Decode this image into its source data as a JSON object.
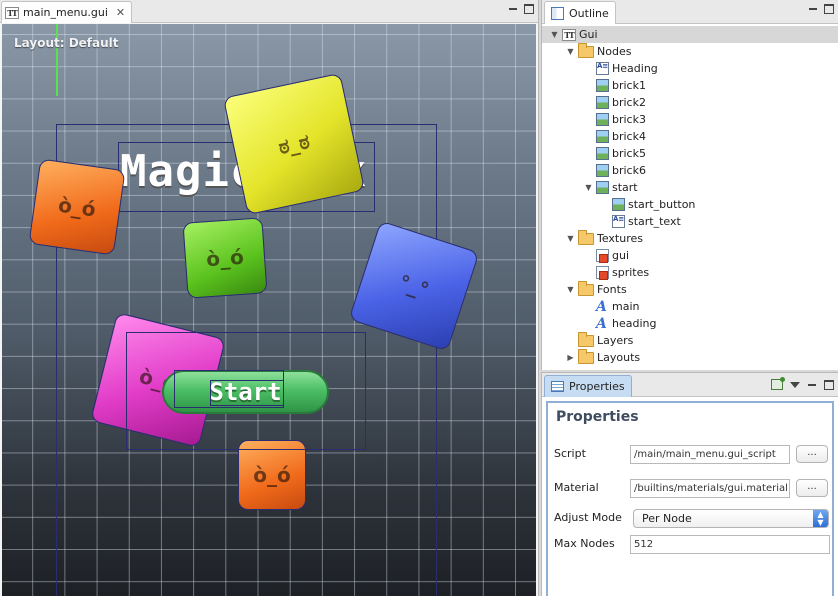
{
  "editor": {
    "tab_label": "main_menu.gui",
    "layout_label": "Layout: Default",
    "heading_text": "Magic Box",
    "start_text": "Start"
  },
  "outline": {
    "tab_label": "Outline",
    "tree": {
      "root": "Gui",
      "nodes_folder": "Nodes",
      "nodes": [
        "Heading",
        "brick1",
        "brick2",
        "brick3",
        "brick4",
        "brick5",
        "brick6",
        "start"
      ],
      "start_children": [
        "start_button",
        "start_text"
      ],
      "textures_folder": "Textures",
      "textures": [
        "gui",
        "sprites"
      ],
      "fonts_folder": "Fonts",
      "fonts": [
        "main",
        "heading"
      ],
      "layers_folder": "Layers",
      "layouts_folder": "Layouts"
    }
  },
  "properties": {
    "tab_label": "Properties",
    "title": "Properties",
    "script_label": "Script",
    "script_value": "/main/main_menu.gui_script",
    "material_label": "Material",
    "material_value": "/builtins/materials/gui.material",
    "adjust_mode_label": "Adjust  Mode",
    "adjust_mode_value": "Per Node",
    "max_nodes_label": "Max  Nodes",
    "max_nodes_value": "512",
    "browse_label": "..."
  },
  "colors": {
    "accent_blue": "#2b6fd8",
    "bounds_line": "#2a2d70",
    "guide_green": "#59e24a"
  }
}
